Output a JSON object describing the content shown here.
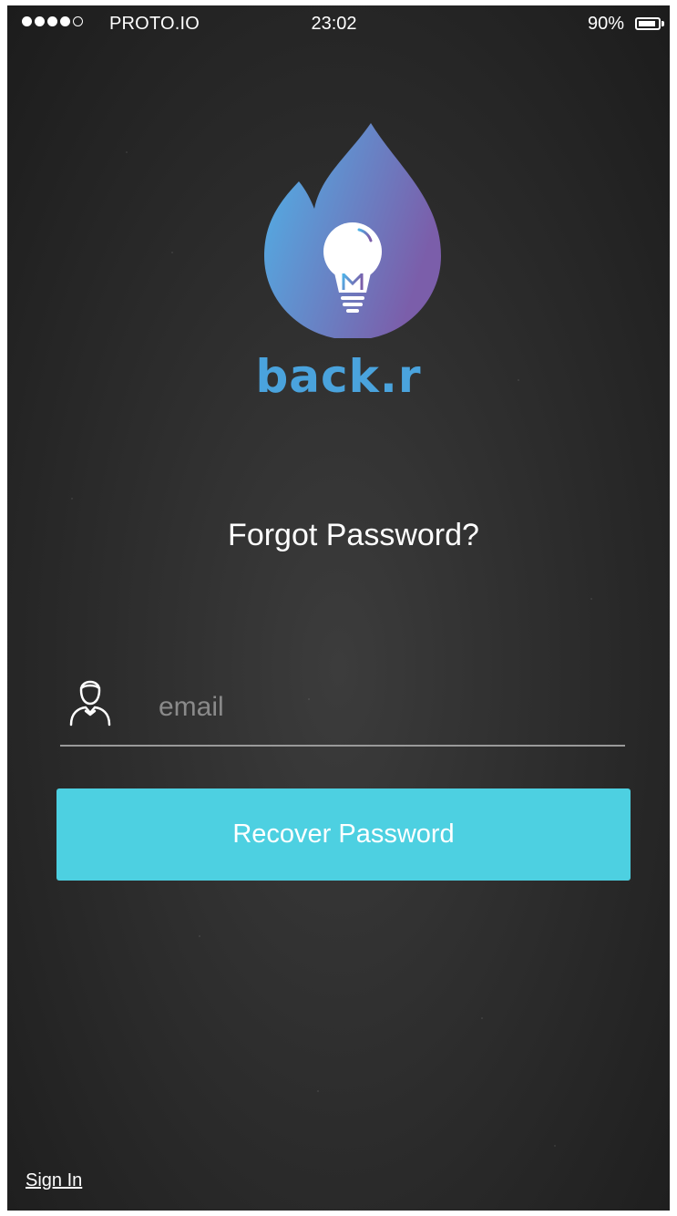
{
  "status_bar": {
    "signal_icon": "signal-dots-icon",
    "carrier": "PROTO.IO",
    "time": "23:02",
    "battery_text": "90%",
    "battery_level": 0.9,
    "battery_icon": "battery-icon"
  },
  "brand": {
    "name": "back.r",
    "logo_icon": "flame-lightbulb-logo",
    "colors": {
      "gradient_start": "#4fb3e8",
      "gradient_end": "#7b5eaa",
      "wordmark": "#4aa3dd"
    }
  },
  "page": {
    "title": "Forgot Password?"
  },
  "form": {
    "email_icon": "user-icon",
    "email_placeholder": "email",
    "email_value": "",
    "recover_label": "Recover Password",
    "recover_color": "#4dd0e1"
  },
  "footer": {
    "sign_in_label": "Sign In"
  }
}
